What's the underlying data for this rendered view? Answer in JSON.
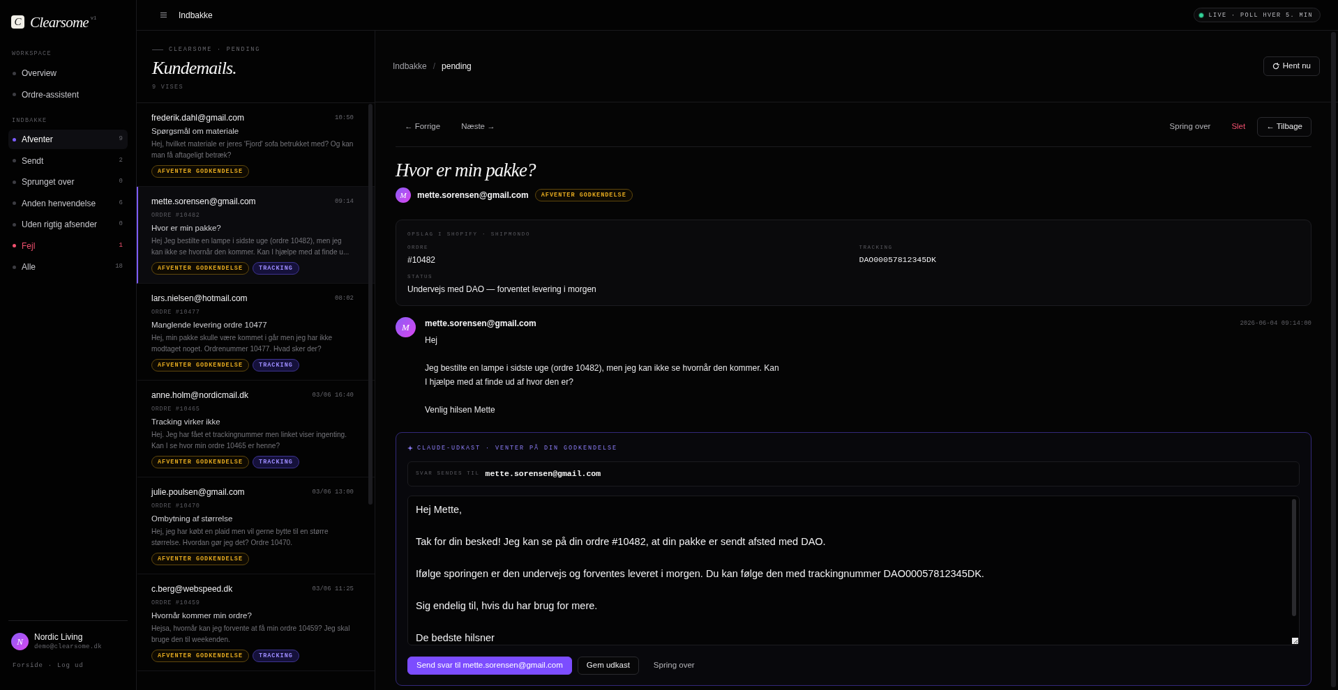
{
  "sidebar": {
    "logo": {
      "mark": "C",
      "name": "Clearsome",
      "version": "v1"
    },
    "sections": [
      {
        "label": "WORKSPACE",
        "items": [
          {
            "label": "Overview",
            "selected": false,
            "kind": "normal"
          },
          {
            "label": "Ordre-assistent",
            "selected": false,
            "kind": "normal"
          }
        ]
      },
      {
        "label": "INDBAKKE",
        "items": [
          {
            "label": "Afventer",
            "count": "9",
            "selected": true,
            "kind": "normal"
          },
          {
            "label": "Sendt",
            "count": "2",
            "selected": false,
            "kind": "normal"
          },
          {
            "label": "Sprunget over",
            "count": "0",
            "selected": false,
            "kind": "normal"
          },
          {
            "label": "Anden henvendelse",
            "count": "6",
            "selected": false,
            "kind": "normal"
          },
          {
            "label": "Uden rigtig afsender",
            "count": "0",
            "selected": false,
            "kind": "normal"
          },
          {
            "label": "Fejl",
            "count": "1",
            "selected": false,
            "kind": "error"
          },
          {
            "label": "Alle",
            "count": "18",
            "selected": false,
            "kind": "normal"
          }
        ]
      }
    ],
    "user": {
      "initial": "N",
      "name": "Nordic Living",
      "email": "demo@clearsome.dk"
    },
    "footer": {
      "links": [
        "Forside",
        "Log ud"
      ],
      "separator": "·"
    }
  },
  "topbar": {
    "title": "Indbakke",
    "live": {
      "on": true,
      "label": "LIVE · POLL HVER 5. MIN"
    }
  },
  "inbox": {
    "eyebrow": "CLEARSOME · PENDING",
    "title": "Kundemails.",
    "count": "9 VISES",
    "emails": [
      {
        "sender": "frederik.dahl@gmail.com",
        "time": "10:50",
        "subject": "Spørgsmål om materiale",
        "preview": "Hej, hvilket materiale er jeres 'Fjord' sofa betrukket med? Og kan man få aftageligt betræk?",
        "tags": [
          {
            "label": "AFVENTER GODKENDELSE",
            "kind": "pending"
          }
        ],
        "selected": false
      },
      {
        "sender": "mette.sorensen@gmail.com",
        "time": "09:14",
        "order": "ORDRE #10482",
        "subject": "Hvor er min pakke?",
        "preview": "Hej Jeg bestilte en lampe i sidste uge (ordre 10482), men jeg kan ikke se hvornår den kommer. Kan I hjælpe med at finde u...",
        "tags": [
          {
            "label": "AFVENTER GODKENDELSE",
            "kind": "pending"
          },
          {
            "label": "TRACKING",
            "kind": "tracking"
          }
        ],
        "selected": true
      },
      {
        "sender": "lars.nielsen@hotmail.com",
        "time": "08:02",
        "order": "ORDRE #10477",
        "subject": "Manglende levering ordre 10477",
        "preview": "Hej, min pakke skulle være kommet i går men jeg har ikke modtaget noget. Ordrenummer 10477. Hvad sker der?",
        "tags": [
          {
            "label": "AFVENTER GODKENDELSE",
            "kind": "pending"
          },
          {
            "label": "TRACKING",
            "kind": "tracking"
          }
        ],
        "selected": false
      },
      {
        "sender": "anne.holm@nordicmail.dk",
        "time": "03/06 16:40",
        "order": "ORDRE #10465",
        "subject": "Tracking virker ikke",
        "preview": "Hej. Jeg har fået et trackingnummer men linket viser ingenting. Kan I se hvor min ordre 10465 er henne?",
        "tags": [
          {
            "label": "AFVENTER GODKENDELSE",
            "kind": "pending"
          },
          {
            "label": "TRACKING",
            "kind": "tracking"
          }
        ],
        "selected": false
      },
      {
        "sender": "julie.poulsen@gmail.com",
        "time": "03/06 13:00",
        "order": "ORDRE #10470",
        "subject": "Ombytning af størrelse",
        "preview": "Hej, jeg har købt en plaid men vil gerne bytte til en større størrelse. Hvordan gør jeg det? Ordre 10470.",
        "tags": [
          {
            "label": "AFVENTER GODKENDELSE",
            "kind": "pending"
          }
        ],
        "selected": false
      },
      {
        "sender": "c.berg@webspeed.dk",
        "time": "03/06 11:25",
        "order": "ORDRE #10459",
        "subject": "Hvornår kommer min ordre?",
        "preview": "Hejsa, hvornår kan jeg forvente at få min ordre 10459? Jeg skal bruge den til weekenden.",
        "tags": [
          {
            "label": "AFVENTER GODKENDELSE",
            "kind": "pending"
          },
          {
            "label": "TRACKING",
            "kind": "tracking"
          }
        ],
        "selected": false
      }
    ]
  },
  "detail": {
    "breadcrumb": [
      {
        "label": "Indbakke",
        "current": false
      },
      {
        "label": "pending",
        "current": true
      }
    ],
    "breadcrumb_separator": "/",
    "refresh_button": "Hent nu",
    "nav": [
      {
        "label": "← Forrige"
      },
      {
        "label": "Næste →"
      }
    ],
    "actions": [
      {
        "label": "Spring over",
        "kind": "plain"
      },
      {
        "label": "Slet",
        "kind": "danger"
      },
      {
        "label": "← Tilbage",
        "kind": "outline"
      }
    ],
    "subject": "Hvor er min pakke?",
    "sender": {
      "initial": "M",
      "email": "mette.sorensen@gmail.com",
      "tags": [
        {
          "label": "AFVENTER GODKENDELSE",
          "kind": "pending"
        }
      ]
    },
    "lookup": {
      "title": "OPSLAG I SHOPIFY · SHIPMONDO",
      "fields": [
        {
          "label": "ORDRE",
          "value": "#10482",
          "kind": "text"
        },
        {
          "label": "TRACKING",
          "value": "DAO00057812345DK",
          "kind": "code"
        },
        {
          "label": "STATUS",
          "value": "Undervejs med DAO — forventet levering i morgen",
          "kind": "text"
        }
      ]
    },
    "message": {
      "initial": "M",
      "sender": "mette.sorensen@gmail.com",
      "timestamp": "2026-06-04 09:14:00",
      "paragraphs": [
        [
          "Hej"
        ],
        [
          "Jeg bestilte en lampe i sidste uge (ordre 10482), men jeg kan ikke se hvornår den kommer. Kan",
          "I hjælpe med at finde ud af hvor den er?"
        ],
        [
          "Venlig hilsen Mette"
        ]
      ]
    },
    "draft": {
      "label": "CLAUDE-UDKAST · VENTER PÅ DIN GODKENDELSE",
      "recipient_label": "SVAR SENDES TIL",
      "recipient": "mette.sorensen@gmail.com",
      "body": [
        "Hej Mette,",
        "Tak for din besked! Jeg kan se på din ordre #10482, at din pakke er sendt afsted med DAO.",
        "Ifølge sporingen er den undervejs og forventes leveret i morgen. Du kan følge den med trackingnummer DAO00057812345DK.",
        "Sig endelig til, hvis du har brug for mere.",
        "De bedste hilsner"
      ],
      "buttons": [
        {
          "label": "Send svar til mette.sorensen@gmail.com",
          "kind": "primary"
        },
        {
          "label": "Gem udkast",
          "kind": "outline"
        },
        {
          "label": "Spring over",
          "kind": "plain"
        }
      ]
    }
  }
}
